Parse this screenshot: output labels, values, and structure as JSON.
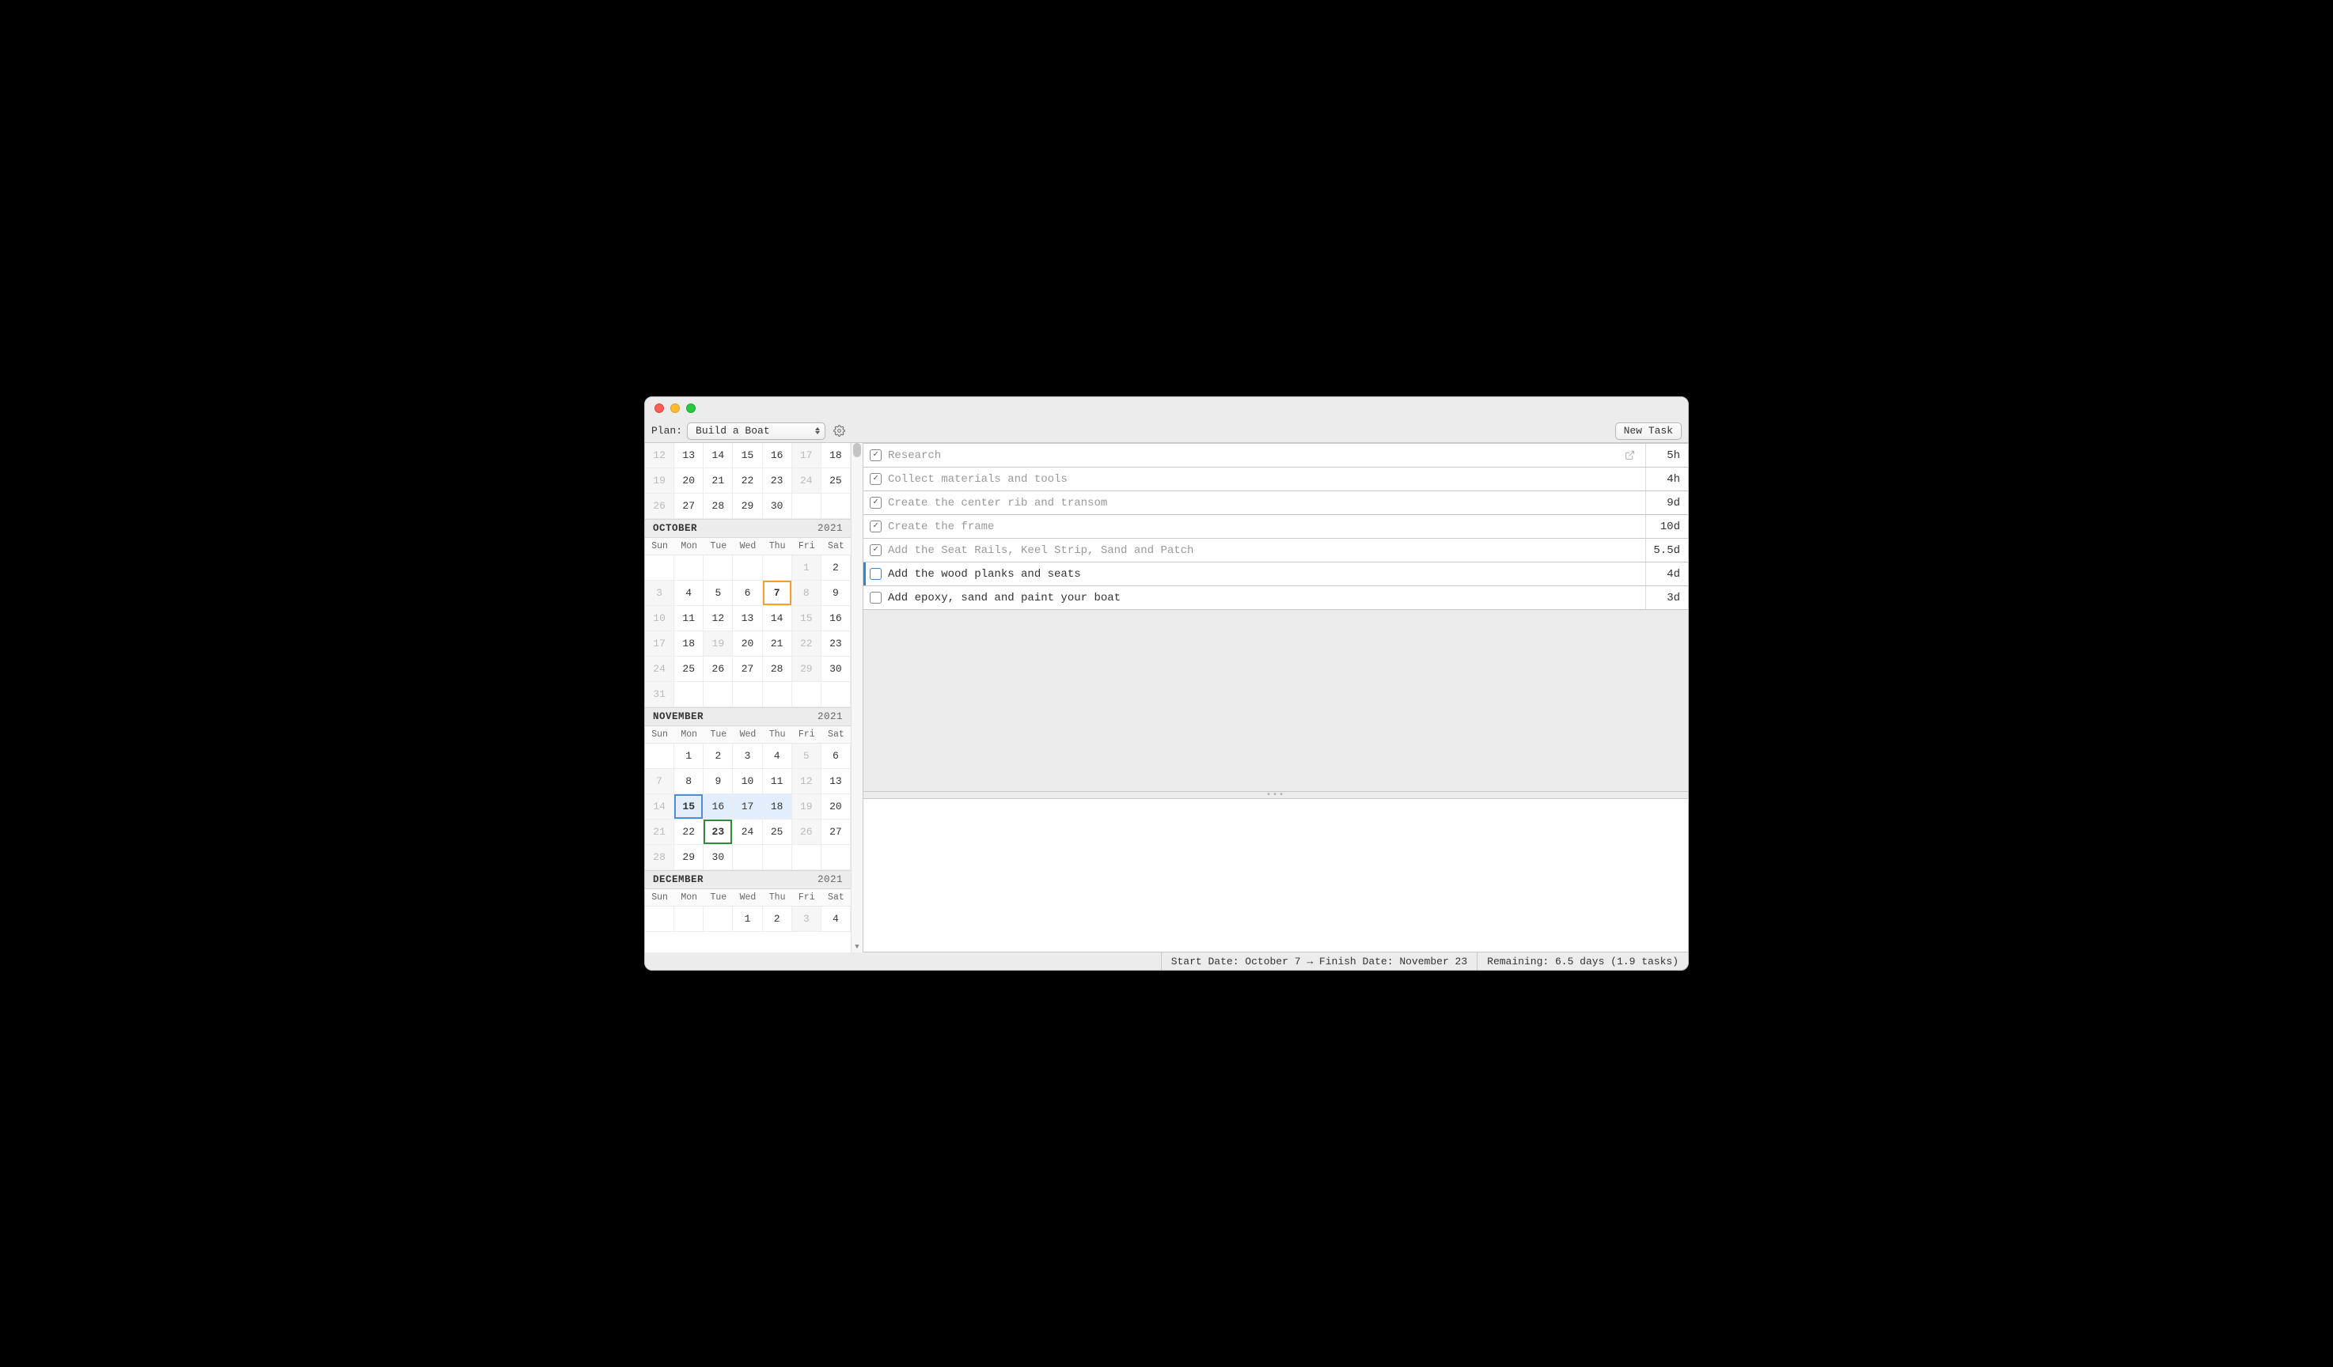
{
  "toolbar": {
    "plan_label": "Plan:",
    "plan_value": "Build a Boat",
    "new_task_label": "New Task"
  },
  "dow": [
    "Sun",
    "Mon",
    "Tue",
    "Wed",
    "Thu",
    "Fri",
    "Sat"
  ],
  "months": {
    "partial_top": {
      "weeks": [
        [
          {
            "n": "12",
            "dim": true
          },
          {
            "n": "13"
          },
          {
            "n": "14"
          },
          {
            "n": "15"
          },
          {
            "n": "16"
          },
          {
            "n": "17",
            "dim": true
          },
          {
            "n": "18"
          }
        ],
        [
          {
            "n": "19",
            "dim": true
          },
          {
            "n": "20"
          },
          {
            "n": "21"
          },
          {
            "n": "22"
          },
          {
            "n": "23"
          },
          {
            "n": "24",
            "dim": true
          },
          {
            "n": "25"
          }
        ],
        [
          {
            "n": "26",
            "dim": true
          },
          {
            "n": "27"
          },
          {
            "n": "28"
          },
          {
            "n": "29"
          },
          {
            "n": "30"
          },
          {
            "n": ""
          },
          {
            "n": ""
          }
        ]
      ]
    },
    "october": {
      "name": "OCTOBER",
      "year": "2021",
      "weeks": [
        [
          {
            "n": ""
          },
          {
            "n": ""
          },
          {
            "n": ""
          },
          {
            "n": ""
          },
          {
            "n": ""
          },
          {
            "n": "1",
            "dim": true
          },
          {
            "n": "2"
          }
        ],
        [
          {
            "n": "3",
            "dim": true
          },
          {
            "n": "4"
          },
          {
            "n": "5"
          },
          {
            "n": "6"
          },
          {
            "n": "7",
            "hl": "orange"
          },
          {
            "n": "8",
            "dim": true
          },
          {
            "n": "9"
          }
        ],
        [
          {
            "n": "10",
            "dim": true
          },
          {
            "n": "11"
          },
          {
            "n": "12"
          },
          {
            "n": "13"
          },
          {
            "n": "14"
          },
          {
            "n": "15",
            "dim": true
          },
          {
            "n": "16"
          }
        ],
        [
          {
            "n": "17",
            "dim": true
          },
          {
            "n": "18"
          },
          {
            "n": "19",
            "dim": true
          },
          {
            "n": "20"
          },
          {
            "n": "21"
          },
          {
            "n": "22",
            "dim": true
          },
          {
            "n": "23"
          }
        ],
        [
          {
            "n": "24",
            "dim": true
          },
          {
            "n": "25"
          },
          {
            "n": "26"
          },
          {
            "n": "27"
          },
          {
            "n": "28"
          },
          {
            "n": "29",
            "dim": true
          },
          {
            "n": "30"
          }
        ],
        [
          {
            "n": "31",
            "dim": true
          },
          {
            "n": ""
          },
          {
            "n": ""
          },
          {
            "n": ""
          },
          {
            "n": ""
          },
          {
            "n": ""
          },
          {
            "n": ""
          }
        ]
      ]
    },
    "november": {
      "name": "NOVEMBER",
      "year": "2021",
      "weeks": [
        [
          {
            "n": ""
          },
          {
            "n": "1"
          },
          {
            "n": "2"
          },
          {
            "n": "3"
          },
          {
            "n": "4"
          },
          {
            "n": "5",
            "dim": true
          },
          {
            "n": "6"
          }
        ],
        [
          {
            "n": "7",
            "dim": true
          },
          {
            "n": "8"
          },
          {
            "n": "9"
          },
          {
            "n": "10"
          },
          {
            "n": "11"
          },
          {
            "n": "12",
            "dim": true
          },
          {
            "n": "13"
          }
        ],
        [
          {
            "n": "14",
            "dim": true
          },
          {
            "n": "15",
            "hl": "blue",
            "range": true
          },
          {
            "n": "16",
            "range": true
          },
          {
            "n": "17",
            "range": true
          },
          {
            "n": "18",
            "range": true
          },
          {
            "n": "19",
            "dim": true
          },
          {
            "n": "20"
          }
        ],
        [
          {
            "n": "21",
            "dim": true
          },
          {
            "n": "22"
          },
          {
            "n": "23",
            "hl": "green"
          },
          {
            "n": "24"
          },
          {
            "n": "25"
          },
          {
            "n": "26",
            "dim": true
          },
          {
            "n": "27"
          }
        ],
        [
          {
            "n": "28",
            "dim": true
          },
          {
            "n": "29"
          },
          {
            "n": "30"
          },
          {
            "n": ""
          },
          {
            "n": ""
          },
          {
            "n": ""
          },
          {
            "n": ""
          }
        ]
      ]
    },
    "december": {
      "name": "DECEMBER",
      "year": "2021",
      "weeks": [
        [
          {
            "n": ""
          },
          {
            "n": ""
          },
          {
            "n": ""
          },
          {
            "n": "1"
          },
          {
            "n": "2"
          },
          {
            "n": "3",
            "dim": true
          },
          {
            "n": "4"
          }
        ]
      ]
    }
  },
  "tasks": [
    {
      "title": "Research",
      "duration": "5h",
      "done": true,
      "has_link": true,
      "selected": false
    },
    {
      "title": "Collect materials and tools",
      "duration": "4h",
      "done": true,
      "has_link": false,
      "selected": false
    },
    {
      "title": "Create the center rib and transom",
      "duration": "9d",
      "done": true,
      "has_link": false,
      "selected": false
    },
    {
      "title": "Create the frame",
      "duration": "10d",
      "done": true,
      "has_link": false,
      "selected": false
    },
    {
      "title": "Add the Seat Rails, Keel Strip, Sand and Patch",
      "duration": "5.5d",
      "done": true,
      "has_link": false,
      "selected": false
    },
    {
      "title": "Add the wood planks and seats",
      "duration": "4d",
      "done": false,
      "has_link": false,
      "selected": true
    },
    {
      "title": "Add epoxy, sand and paint your boat",
      "duration": "3d",
      "done": false,
      "has_link": false,
      "selected": false
    }
  ],
  "divider_dots": "•••",
  "status": {
    "dates": "Start Date: October 7 → Finish Date: November 23",
    "remaining": "Remaining: 6.5 days (1.9 tasks)"
  }
}
